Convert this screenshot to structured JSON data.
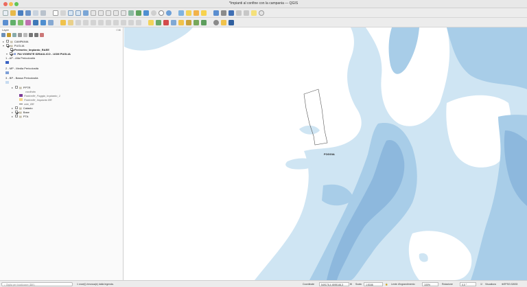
{
  "window": {
    "title": "*Impianti al confine con la campania — QGIS"
  },
  "panel": {
    "title": "Layer",
    "controls": "⊡⊠"
  },
  "layers": [
    {
      "label": "CAMPANIA"
    },
    {
      "label": "PUGLIA"
    },
    {
      "label": "Perimetro_Impianto_RAEE"
    },
    {
      "label": "PAI VIGENTE IDRAULICO - UOM PUGLIA"
    },
    {
      "label": "1 - AP - Alta Pericolosità"
    },
    {
      "label": "2 - MP - Media Pericolosità"
    },
    {
      "label": "3 - BP - Bassa Pericolosità"
    },
    {
      "label": "PPTR"
    },
    {
      "label": "confinito"
    },
    {
      "label": "Particelle_Foggia_Impianto_1"
    },
    {
      "label": "Particelle_Impianto BR"
    },
    {
      "label": "rete_BR"
    },
    {
      "label": "Catasto"
    },
    {
      "label": "Base"
    },
    {
      "label": "PTA"
    }
  ],
  "colors": {
    "alta": "#3a63c4",
    "media": "#7ea0d8",
    "bassa": "#c7dbf0",
    "flood_light": "#cfe5f3",
    "flood_mid": "#a8cde8",
    "flood_dark": "#8db8dd"
  },
  "map": {
    "city_label": "FOGGIA"
  },
  "statusbar": {
    "search_placeholder": "Digita per localizzare (⌘K)",
    "message": "1 voce(i) rimossa(e) dalla legenda.",
    "coord_label": "Coordinate",
    "coord_value": "549176,4 4595146,3",
    "scale_label": "Scala",
    "scale_value": "1:5166",
    "magnifier_label": "Lente d'ingrandimento",
    "magnifier_value": "100%",
    "rotation_label": "Rotazione",
    "rotation_value": "0,0 °",
    "render_label": "Visualizza",
    "crs_label": "EPSG:32633"
  }
}
